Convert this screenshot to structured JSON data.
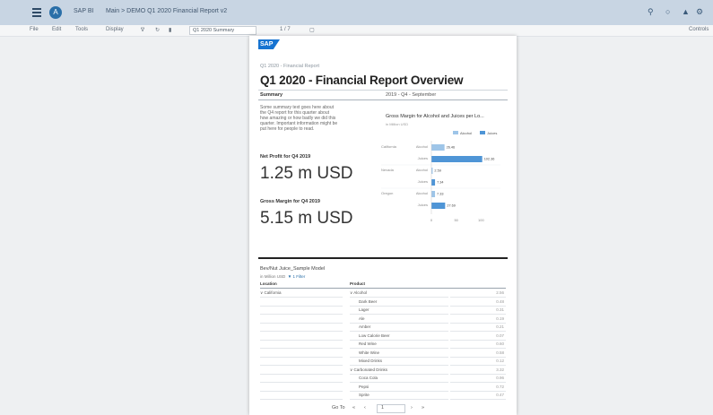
{
  "shell": {
    "avatar_letter": "A",
    "app_label": "SAP BI",
    "doc_label": "Main > DEMO Q1 2020 Financial Report v2",
    "icons": [
      "menu-icon",
      "search-icon",
      "help-icon",
      "notifications-icon",
      "settings-icon"
    ]
  },
  "toolbar": {
    "file": "File",
    "edit": "Edit",
    "tools": "Tools",
    "display": "Display",
    "view": "Q1 2020 Summary",
    "page": "1 / 7",
    "right": "Controls"
  },
  "report": {
    "logo": "SAP",
    "crumb": "Q1 2020 - Financial Report",
    "title": "Q1 2020 - Financial Report Overview",
    "summary_label": "Summary",
    "period": "2019 - Q4 - September",
    "summary_text": [
      "Some summary text goes here about",
      "the Q4 report for this quarter about",
      "how amazing or how badly we did this",
      "quarter. Important information might be",
      "put here for people to read."
    ],
    "kpi1_label": "Net Profit for Q4 2019",
    "kpi1_value": "1.25 m USD",
    "kpi2_label": "Gross Margin for Q4 2019",
    "kpi2_value": "5.15 m USD",
    "chart_title": "Gross Margin for Alcohol and Juices per Lo...",
    "chart_unit": "in Million USD"
  },
  "chart_data": {
    "type": "bar",
    "orientation": "horizontal",
    "title": "Gross Margin for Alcohol and Juices per Lo...",
    "legend_position": "top-right",
    "series": [
      {
        "name": "Alcohol",
        "color": "#9ec5e8"
      },
      {
        "name": "Juices",
        "color": "#4f95d6"
      }
    ],
    "groups": [
      {
        "location": "California",
        "rows": [
          {
            "product": "Alcohol",
            "value": 26.46,
            "label": "26.46"
          },
          {
            "product": "Juices",
            "value": 102.36,
            "label": "102.36"
          }
        ]
      },
      {
        "location": "Nevada",
        "rows": [
          {
            "product": "Alcohol",
            "value": 2.59,
            "label": "2.59"
          },
          {
            "product": "Juices",
            "value": 7.34,
            "label": "7.34"
          }
        ]
      },
      {
        "location": "Oregon",
        "rows": [
          {
            "product": "Alcohol",
            "value": 7.33,
            "label": "7.33"
          },
          {
            "product": "Juices",
            "value": 27.69,
            "label": "27.69"
          }
        ]
      }
    ],
    "xlim": [
      0,
      130
    ],
    "ticks": [
      "0",
      "50",
      "100"
    ]
  },
  "table": {
    "title": "Bev/Nut Juice_Sample Model",
    "subtitle": "in Million USD",
    "filter": "1 Filter",
    "col_location": "Location",
    "col_product": "Product",
    "rows": [
      {
        "location": "∨ California",
        "product": "∨ Alcohol",
        "value": "2.56"
      },
      {
        "location": "",
        "product": "Dark Beer",
        "value": "0.48"
      },
      {
        "location": "",
        "product": "Lager",
        "value": "0.31"
      },
      {
        "location": "",
        "product": "Ale",
        "value": "0.19"
      },
      {
        "location": "",
        "product": "Amber",
        "value": "0.21"
      },
      {
        "location": "",
        "product": "Low Calorie Beer",
        "value": "0.07"
      },
      {
        "location": "",
        "product": "Red Wine",
        "value": "0.60"
      },
      {
        "location": "",
        "product": "White Wine",
        "value": "0.58"
      },
      {
        "location": "",
        "product": "Mixed Drinks",
        "value": "0.12"
      },
      {
        "location": "",
        "product": "∨ Carbonated Drinks",
        "value": "3.32"
      },
      {
        "location": "",
        "product": "Coca Cola",
        "value": "0.96"
      },
      {
        "location": "",
        "product": "Pepsi",
        "value": "0.72"
      },
      {
        "location": "",
        "product": "Sprite",
        "value": "0.47"
      }
    ]
  },
  "pager": {
    "goto": "Go To",
    "value": "1"
  }
}
